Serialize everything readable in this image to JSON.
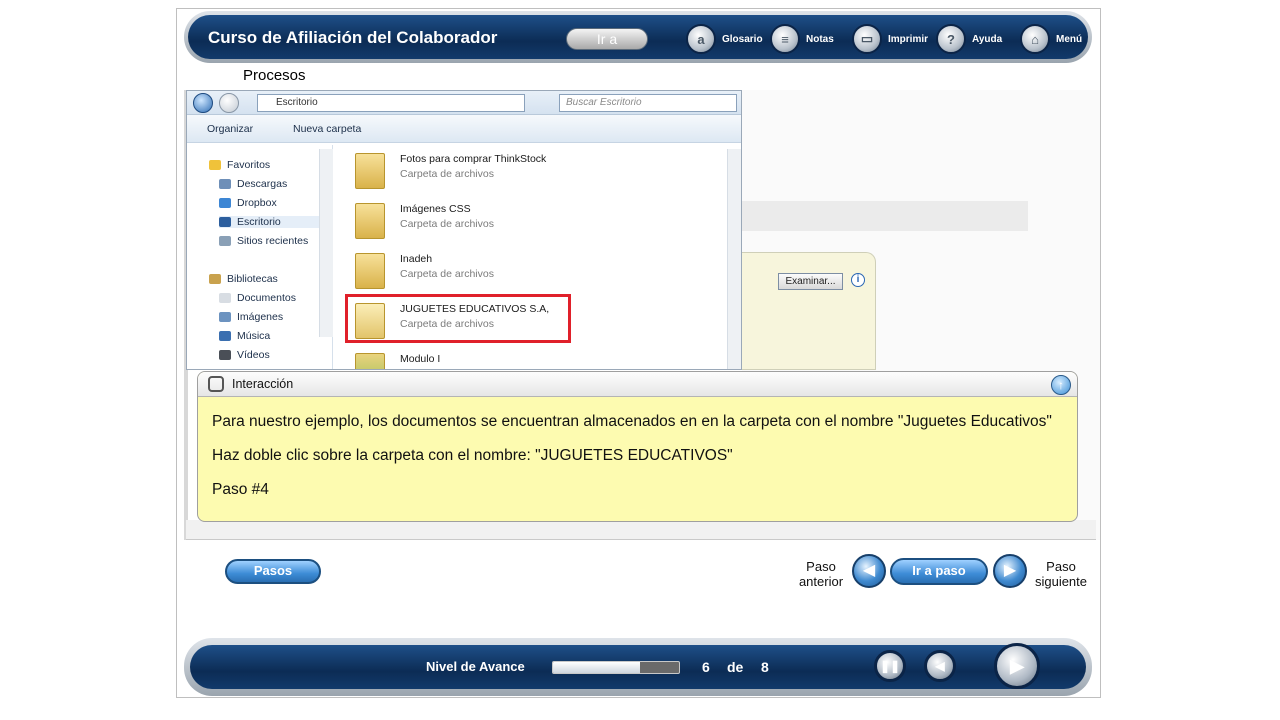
{
  "header": {
    "course_title": "Curso de Afiliación del Colaborador",
    "go_button": "Ir a",
    "tools": [
      {
        "label": "Glosario",
        "icon": "glossary-icon"
      },
      {
        "label": "Notas",
        "icon": "notes-icon"
      },
      {
        "label": "Imprimir",
        "icon": "print-icon"
      },
      {
        "label": "Ayuda",
        "icon": "help-icon"
      },
      {
        "label": "Menú",
        "icon": "menu-icon"
      }
    ]
  },
  "section_title": "Procesos",
  "explorer": {
    "address": "Escritorio",
    "search_placeholder": "Buscar Escritorio",
    "organize": "Organizar",
    "new_folder": "Nueva carpeta",
    "nav": {
      "favorites": "Favoritos",
      "favorites_items": [
        "Descargas",
        "Dropbox",
        "Escritorio",
        "Sitios recientes"
      ],
      "libraries": "Bibliotecas",
      "libraries_items": [
        "Documentos",
        "Imágenes",
        "Música",
        "Vídeos"
      ]
    },
    "files": [
      {
        "name": "Fotos para comprar ThinkStock",
        "type": "Carpeta de archivos"
      },
      {
        "name": "Imágenes CSS",
        "type": "Carpeta de archivos"
      },
      {
        "name": "Inadeh",
        "type": "Carpeta de archivos"
      },
      {
        "name": "JUGUETES EDUCATIVOS S.A,",
        "type": "Carpeta de archivos"
      },
      {
        "name": "Modulo I",
        "type": ""
      }
    ]
  },
  "background_app": {
    "browse_button": "Examinar...",
    "info_glyph": "i"
  },
  "interaction": {
    "title": "Interacción",
    "text1": "Para nuestro ejemplo, los documentos se encuentran almacenados en en la carpeta con el nombre \"Juguetes Educativos\"",
    "text2": "Haz doble clic sobre la carpeta con el nombre: \"JUGUETES EDUCATIVOS\"",
    "text3": "Paso #4"
  },
  "controls": {
    "steps_button": "Pasos",
    "prev_label_1": "Paso",
    "prev_label_2": "anterior",
    "goto_step_button": "Ir a paso",
    "next_label_1": "Paso",
    "next_label_2": "siguiente"
  },
  "footer": {
    "progress_label": "Nivel de Avance",
    "progress_fraction": 0.69,
    "current_page": "6",
    "of_label": "de",
    "total_pages": "8"
  },
  "colors": {
    "navy": "#0c2c55",
    "highlight_red": "#e0202a",
    "note_yellow": "#fdfbb0",
    "button_blue": "#3d8cd6"
  }
}
